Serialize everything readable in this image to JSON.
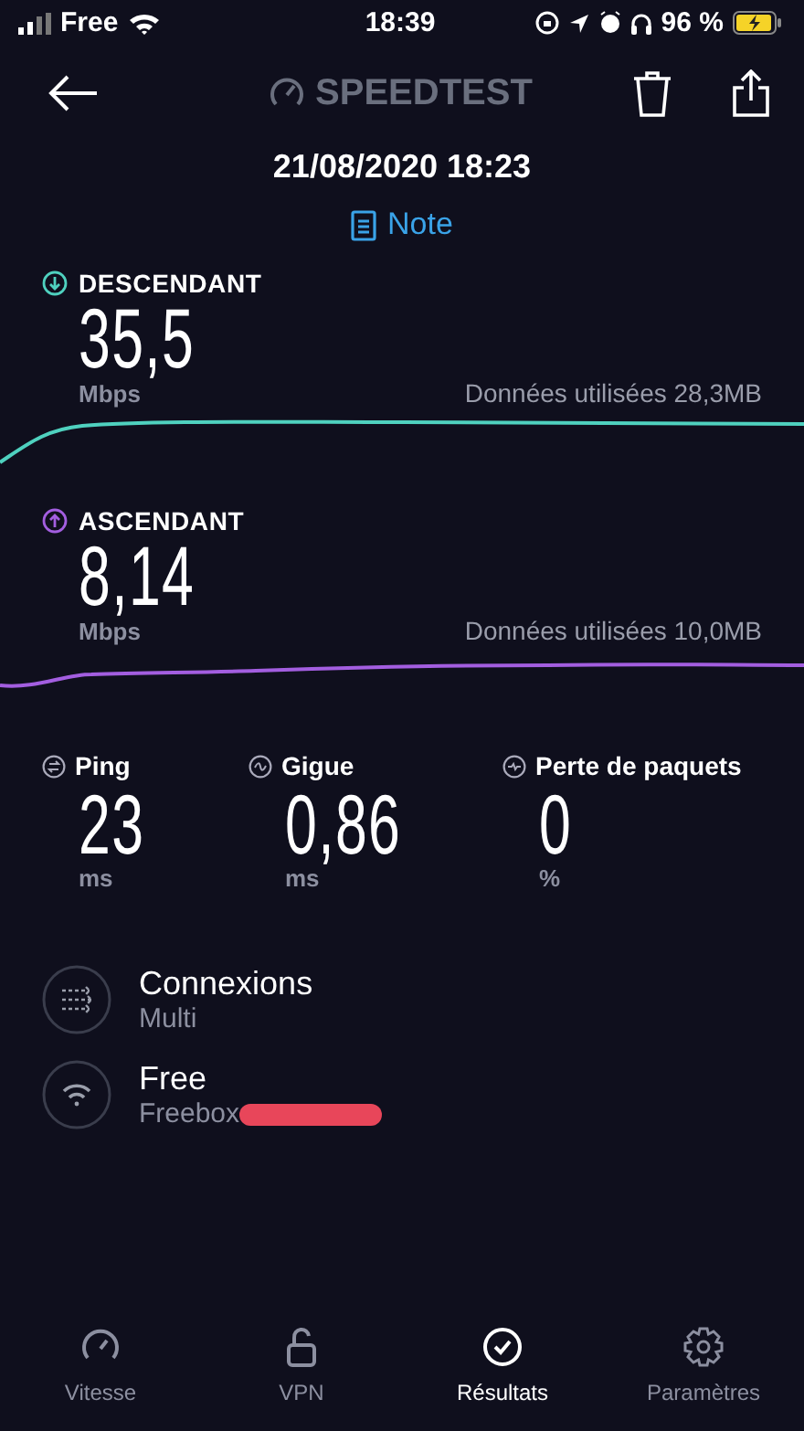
{
  "status_bar": {
    "carrier": "Free",
    "time": "18:39",
    "battery": "96 %",
    "charging": true
  },
  "header": {
    "logo": "SPEEDTEST"
  },
  "date": "21/08/2020 18:23",
  "note": "Note",
  "speeds": [
    {
      "kind": "download",
      "label": "DESCENDANT",
      "value": "35,5",
      "unit": "Mbps",
      "data_used": "Données utilisées 28,3MB",
      "color": "#4fd1bf"
    },
    {
      "kind": "upload",
      "label": "ASCENDANT",
      "value": "8,14",
      "unit": "Mbps",
      "data_used": "Données utilisées 10,0MB",
      "color": "#a35ee0"
    }
  ],
  "metrics": [
    {
      "kind": "ping",
      "label": "Ping",
      "value": "23",
      "unit": "ms"
    },
    {
      "kind": "jitter",
      "label": "Gigue",
      "value": "0,86",
      "unit": "ms"
    },
    {
      "kind": "loss",
      "label": "Perte de paquets",
      "value": "0",
      "unit": "%"
    }
  ],
  "details": [
    {
      "kind": "connections",
      "title": "Connexions",
      "subtitle": "Multi"
    },
    {
      "kind": "wifi",
      "title": "Free",
      "subtitle": "Freebox",
      "redacted": true
    }
  ],
  "tabs": [
    {
      "kind": "speed",
      "label": "Vitesse",
      "selected": false
    },
    {
      "kind": "vpn",
      "label": "VPN",
      "selected": false
    },
    {
      "kind": "results",
      "label": "Résultats",
      "selected": true
    },
    {
      "kind": "settings",
      "label": "Paramètres",
      "selected": false
    }
  ]
}
